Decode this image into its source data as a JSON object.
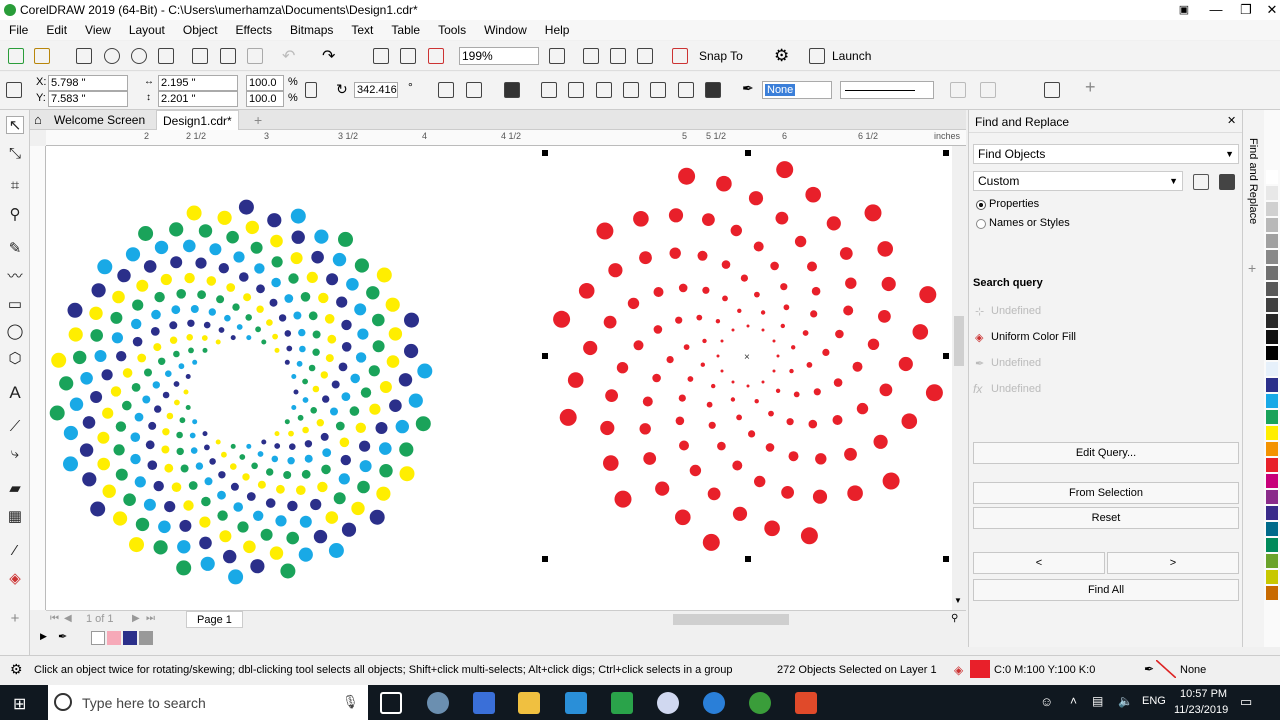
{
  "titlebar": {
    "title": "CorelDRAW 2019 (64-Bit) - C:\\Users\\umerhamza\\Documents\\Design1.cdr*",
    "minimize": "—",
    "restore": "❐",
    "close": "✕"
  },
  "menu": [
    "File",
    "Edit",
    "View",
    "Layout",
    "Object",
    "Effects",
    "Bitmaps",
    "Text",
    "Table",
    "Tools",
    "Window",
    "Help"
  ],
  "toolbar": {
    "zoom": "199%",
    "snap_to": "Snap To",
    "launch": "Launch"
  },
  "props": {
    "x_label": "X:",
    "x": "5.798 \"",
    "y_label": "Y:",
    "y": "7.583 \"",
    "w": "2.195 \"",
    "h": "2.201 \"",
    "sx": "100.0",
    "sy": "100.0",
    "pct": "%",
    "angle": "342.416",
    "deg": "°",
    "outline": "None"
  },
  "tabs": {
    "welcome": "Welcome Screen",
    "doc": "Design1.cdr*",
    "add": "+"
  },
  "ruler": {
    "units": "inches",
    "ticks": [
      "2",
      "2 1/2",
      "3",
      "3 1/2",
      "4",
      "4 1/2",
      "5",
      "5 1/2",
      "6",
      "6 1/2"
    ]
  },
  "pagebar": {
    "page_of": "1 of 1",
    "page": "Page 1"
  },
  "docker": {
    "title": "Find and Replace",
    "mode": "Find Objects",
    "preset": "Custom",
    "opt_properties": "Properties",
    "opt_names": "Names or Styles",
    "search_header": "Search query",
    "q1": "Undefined",
    "q2": "Uniform Color Fill",
    "q3": "Undefined",
    "q4": "Undefined",
    "edit_query": "Edit Query...",
    "from_selection": "From Selection",
    "reset": "Reset",
    "prev": "<",
    "next": ">",
    "find_all": "Find All",
    "vtab_label": "Find and Replace"
  },
  "status": {
    "hint": "Click an object twice for rotating/skewing; dbl-clicking tool selects all objects; Shift+click multi-selects; Alt+click digs; Ctrl+click selects in a group",
    "selection": "272 Objects Selected on Layer 1",
    "fill": "C:0 M:100 Y:100 K:0",
    "outline": "None"
  },
  "taskbar": {
    "search": "Type here to search",
    "lang": "ENG",
    "time": "10:57 PM",
    "date": "11/23/2019"
  },
  "colors": {
    "accent_red": "#e8202a",
    "blue": "#2b2f8a",
    "cyan": "#19a9e6",
    "green": "#1aa35a",
    "yellow": "#ffee00"
  }
}
